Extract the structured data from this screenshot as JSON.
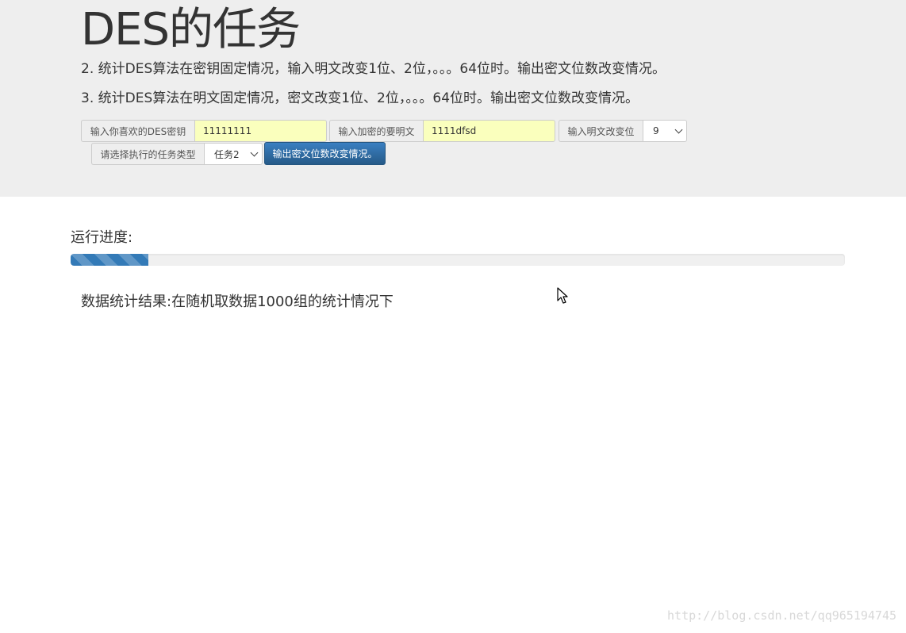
{
  "header": {
    "title": "DES的任务",
    "tasks": [
      "2. 统计DES算法在密钥固定情况，输入明文改变1位、2位，。。。64位时。输出密文位数改变情况。",
      "3. 统计DES算法在明文固定情况，密文改变1位、2位，。。。64位时。输出密文位数改变情况。"
    ]
  },
  "form": {
    "key_label": "输入你喜欢的DES密钥",
    "key_value": "11111111",
    "plaintext_label": "输入加密的要明文",
    "plaintext_value": "1111dfsd",
    "bits_label": "输入明文改变位",
    "bits_value": "9",
    "task_label": "请选择执行的任务类型",
    "task_value": "任务2",
    "submit_label": "输出密文位数改变情况。"
  },
  "progress": {
    "label": "运行进度:",
    "percent": 10,
    "color": "#337ab7"
  },
  "result": {
    "text": "数据统计结果:在随机取数据1000组的统计情况下"
  },
  "watermark": "http://blog.csdn.net/qq965194745",
  "icons": {
    "select_arrow": "chevron-down-icon",
    "cursor": "mouse-pointer-icon"
  }
}
